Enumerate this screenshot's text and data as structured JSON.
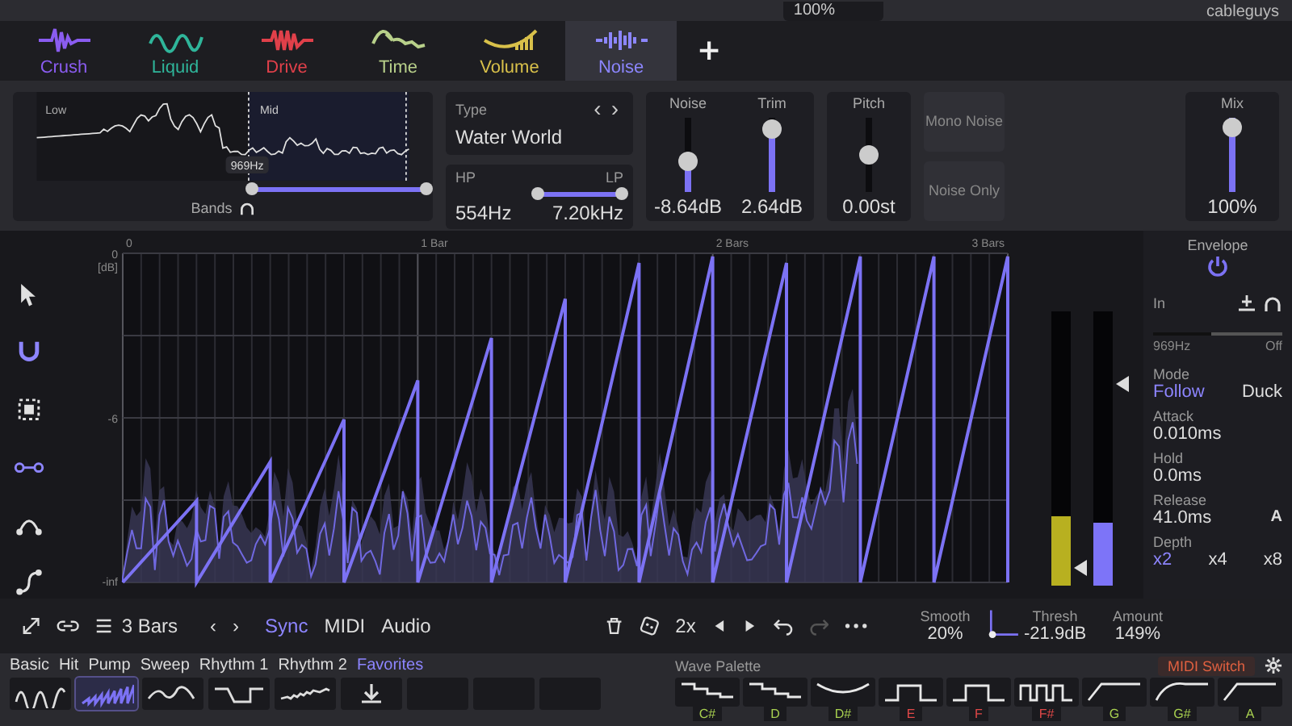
{
  "header": {
    "zoom": "100%",
    "brand": "cableguys"
  },
  "tabs": [
    {
      "kind": "crush",
      "label": "Crush",
      "color": "#8a5cf0",
      "selected": false
    },
    {
      "kind": "liquid",
      "label": "Liquid",
      "color": "#2fb59a",
      "selected": false
    },
    {
      "kind": "drive",
      "label": "Drive",
      "color": "#e0404a",
      "selected": false
    },
    {
      "kind": "time",
      "label": "Time",
      "color": "#b8d08a",
      "selected": false
    },
    {
      "kind": "volume",
      "label": "Volume",
      "color": "#d8c04a",
      "selected": false
    },
    {
      "kind": "noise",
      "label": "Noise",
      "color": "#8c86ff",
      "selected": true
    }
  ],
  "add_tab": "+",
  "bands": {
    "low_label": "Low",
    "mid_label": "Mid",
    "crossover": "969Hz",
    "bands_label": "Bands",
    "handles": [
      {
        "level": 0.57
      },
      {
        "level": 1.0
      }
    ]
  },
  "type": {
    "label": "Type",
    "value": "Water World",
    "prev": "‹",
    "next": "›"
  },
  "filter": {
    "hp_label": "HP",
    "lp_label": "LP",
    "hp": "554Hz",
    "lp": "7.20kHz",
    "handles": [
      {
        "level": 0.45
      },
      {
        "level": 0.95
      }
    ]
  },
  "sliders": [
    {
      "kind": "fill",
      "label": "Noise",
      "reading": "-8.64dB",
      "level": 0.4
    },
    {
      "kind": "fill",
      "label": "Trim",
      "reading": "2.64dB",
      "level": 0.85
    },
    {
      "kind": "center",
      "label": "Pitch",
      "reading": "0.00st",
      "level": 0.5
    }
  ],
  "toggles": [
    {
      "label": "Mono Noise",
      "on": false
    },
    {
      "label": "Noise Only",
      "on": false
    }
  ],
  "mix": {
    "label": "Mix",
    "reading": "100%",
    "level": 1.0
  },
  "graph": {
    "x_labels": [
      "0",
      "1 Bar",
      "2 Bars",
      "3 Bars"
    ],
    "y_labels": [
      "0",
      "[dB]",
      "-6",
      "-inf"
    ]
  },
  "tools": [
    {
      "kind": "pointer",
      "on": false
    },
    {
      "kind": "magnet",
      "on": true
    },
    {
      "kind": "select",
      "on": false
    },
    {
      "kind": "line",
      "on": true
    },
    {
      "kind": "curve",
      "on": false
    },
    {
      "kind": "s-curve",
      "on": false
    }
  ],
  "meters": {
    "thresh": {
      "level": 0.25
    },
    "amount": {
      "level": 0.23
    }
  },
  "envelope": {
    "title": "Envelope",
    "on": true,
    "in_label": "In",
    "freq": "969Hz",
    "off": "Off",
    "band_slider": {
      "level": 0.45
    },
    "mode_label": "Mode",
    "modes": [
      {
        "label": "Follow",
        "selected": true
      },
      {
        "label": "Duck",
        "selected": false
      }
    ],
    "params": [
      {
        "label": "Attack",
        "value": "0.010ms"
      },
      {
        "label": "Hold",
        "value": "0.0ms"
      },
      {
        "label": "Release",
        "value": "41.0ms"
      }
    ],
    "auto": "A",
    "depth_label": "Depth",
    "depths": [
      {
        "label": "x2",
        "selected": true
      },
      {
        "label": "x4",
        "selected": false
      },
      {
        "label": "x8",
        "selected": false
      }
    ]
  },
  "toolbar": {
    "bars": "3 Bars",
    "prev": "‹",
    "next": "›",
    "sync": [
      {
        "label": "Sync",
        "selected": true
      },
      {
        "label": "MIDI",
        "selected": false
      },
      {
        "label": "Audio",
        "selected": false
      }
    ],
    "speed": "2x",
    "smooth_label": "Smooth",
    "smooth": "20%",
    "thresh_label": "Thresh",
    "thresh": "-21.9dB",
    "amount_label": "Amount",
    "amount": "149%"
  },
  "presets": {
    "categories": [
      {
        "label": "Basic",
        "selected": false
      },
      {
        "label": "Hit",
        "selected": false
      },
      {
        "label": "Pump",
        "selected": false
      },
      {
        "label": "Sweep",
        "selected": false
      },
      {
        "label": "Rhythm 1",
        "selected": false
      },
      {
        "label": "Rhythm 2",
        "selected": false
      },
      {
        "label": "Favorites",
        "selected": true
      }
    ],
    "slots": [
      {
        "kind": "sine",
        "selected": false
      },
      {
        "kind": "saw",
        "selected": true
      },
      {
        "kind": "bump",
        "selected": false
      },
      {
        "kind": "square",
        "selected": false
      },
      {
        "kind": "noise",
        "selected": false
      },
      {
        "kind": "download",
        "selected": false
      },
      {
        "kind": "empty",
        "selected": false
      },
      {
        "kind": "empty",
        "selected": false
      },
      {
        "kind": "empty",
        "selected": false
      }
    ]
  },
  "palette": {
    "title": "Wave Palette",
    "midi_switch": "MIDI Switch",
    "keys": [
      {
        "kind": "step-down",
        "note": "C#",
        "color": "#a8d050"
      },
      {
        "kind": "step-down",
        "note": "D",
        "color": "#a8d050"
      },
      {
        "kind": "dip",
        "note": "D#",
        "color": "#a8d050"
      },
      {
        "kind": "pulse",
        "note": "E",
        "color": "#e04848"
      },
      {
        "kind": "pulse",
        "note": "F",
        "color": "#e04848"
      },
      {
        "kind": "pulses",
        "note": "F#",
        "color": "#e04848"
      },
      {
        "kind": "ramp",
        "note": "G",
        "color": "#a8d050"
      },
      {
        "kind": "curve",
        "note": "G#",
        "color": "#a8d050"
      },
      {
        "kind": "ramp",
        "note": "A",
        "color": "#a8d050"
      }
    ]
  }
}
